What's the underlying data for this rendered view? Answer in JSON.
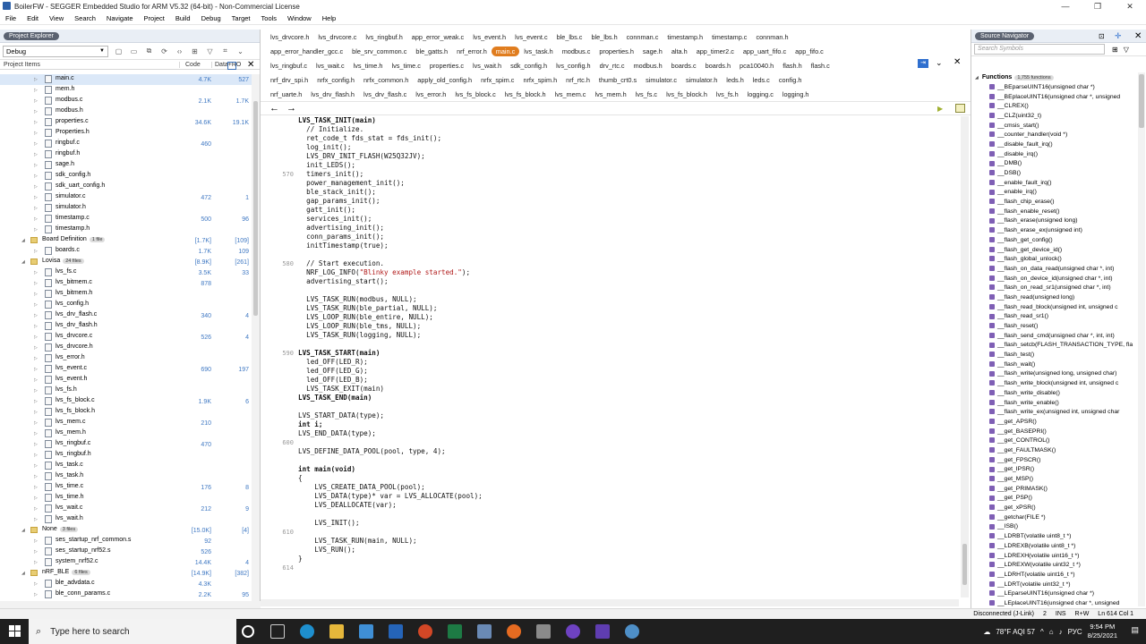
{
  "window": {
    "title": "BoilerFW - SEGGER Embedded Studio for ARM V5.32 (64-bit) - Non-Commercial License",
    "controls": [
      "—",
      "❐",
      "✕"
    ]
  },
  "menu": [
    "File",
    "Edit",
    "View",
    "Search",
    "Navigate",
    "Project",
    "Build",
    "Debug",
    "Target",
    "Tools",
    "Window",
    "Help"
  ],
  "project_explorer": {
    "title": "Project Explorer",
    "config": "Debug",
    "col_items": "Project Items",
    "col_code": "Code",
    "col_data": "Data+RO",
    "rows": [
      {
        "name": "main.c",
        "code": "4.7K",
        "data": "527",
        "indent": 2,
        "type": "file",
        "sel": true
      },
      {
        "name": "mem.h",
        "code": "",
        "data": "",
        "indent": 2,
        "type": "file"
      },
      {
        "name": "modbus.c",
        "code": "2.1K",
        "data": "1.7K",
        "indent": 2,
        "type": "file"
      },
      {
        "name": "modbus.h",
        "code": "",
        "data": "",
        "indent": 2,
        "type": "file"
      },
      {
        "name": "properties.c",
        "code": "34.6K",
        "data": "19.1K",
        "indent": 2,
        "type": "file"
      },
      {
        "name": "Properties.h",
        "code": "",
        "data": "",
        "indent": 2,
        "type": "file"
      },
      {
        "name": "ringbuf.c",
        "code": "460",
        "data": "",
        "indent": 2,
        "type": "file"
      },
      {
        "name": "ringbuf.h",
        "code": "",
        "data": "",
        "indent": 2,
        "type": "file"
      },
      {
        "name": "sage.h",
        "code": "",
        "data": "",
        "indent": 2,
        "type": "file"
      },
      {
        "name": "sdk_config.h",
        "code": "",
        "data": "",
        "indent": 2,
        "type": "file"
      },
      {
        "name": "sdk_uart_config.h",
        "code": "",
        "data": "",
        "indent": 2,
        "type": "file"
      },
      {
        "name": "simulator.c",
        "code": "472",
        "data": "1",
        "indent": 2,
        "type": "file"
      },
      {
        "name": "simulator.h",
        "code": "",
        "data": "",
        "indent": 2,
        "type": "file"
      },
      {
        "name": "timestamp.c",
        "code": "500",
        "data": "96",
        "indent": 2,
        "type": "file"
      },
      {
        "name": "timestamp.h",
        "code": "",
        "data": "",
        "indent": 2,
        "type": "file"
      },
      {
        "name": "Board Definition",
        "badge": "1 file",
        "code": "[1.7K]",
        "data": "[109]",
        "indent": 1,
        "type": "folder"
      },
      {
        "name": "boards.c",
        "code": "1.7K",
        "data": "109",
        "indent": 2,
        "type": "file"
      },
      {
        "name": "Lovisa",
        "badge": "24 files",
        "code": "[8.9K]",
        "data": "[261]",
        "indent": 1,
        "type": "folder"
      },
      {
        "name": "lvs_fs.c",
        "code": "3.5K",
        "data": "33",
        "indent": 2,
        "type": "file"
      },
      {
        "name": "lvs_bitmem.c",
        "code": "878",
        "data": "",
        "indent": 2,
        "type": "file"
      },
      {
        "name": "lvs_bitmem.h",
        "code": "",
        "data": "",
        "indent": 2,
        "type": "file"
      },
      {
        "name": "lvs_config.h",
        "code": "",
        "data": "",
        "indent": 2,
        "type": "file"
      },
      {
        "name": "lvs_drv_flash.c",
        "code": "340",
        "data": "4",
        "indent": 2,
        "type": "file"
      },
      {
        "name": "lvs_drv_flash.h",
        "code": "",
        "data": "",
        "indent": 2,
        "type": "file"
      },
      {
        "name": "lvs_drvcore.c",
        "code": "526",
        "data": "4",
        "indent": 2,
        "type": "file"
      },
      {
        "name": "lvs_drvcore.h",
        "code": "",
        "data": "",
        "indent": 2,
        "type": "file"
      },
      {
        "name": "lvs_error.h",
        "code": "",
        "data": "",
        "indent": 2,
        "type": "file"
      },
      {
        "name": "lvs_event.c",
        "code": "690",
        "data": "197",
        "indent": 2,
        "type": "file"
      },
      {
        "name": "lvs_event.h",
        "code": "",
        "data": "",
        "indent": 2,
        "type": "file"
      },
      {
        "name": "lvs_fs.h",
        "code": "",
        "data": "",
        "indent": 2,
        "type": "file"
      },
      {
        "name": "lvs_fs_block.c",
        "code": "1.9K",
        "data": "6",
        "indent": 2,
        "type": "file"
      },
      {
        "name": "lvs_fs_block.h",
        "code": "",
        "data": "",
        "indent": 2,
        "type": "file"
      },
      {
        "name": "lvs_mem.c",
        "code": "210",
        "data": "",
        "indent": 2,
        "type": "file"
      },
      {
        "name": "lvs_mem.h",
        "code": "",
        "data": "",
        "indent": 2,
        "type": "file"
      },
      {
        "name": "lvs_ringbuf.c",
        "code": "470",
        "data": "",
        "indent": 2,
        "type": "file"
      },
      {
        "name": "lvs_ringbuf.h",
        "code": "",
        "data": "",
        "indent": 2,
        "type": "file"
      },
      {
        "name": "lvs_task.c",
        "code": "",
        "data": "",
        "indent": 2,
        "type": "file"
      },
      {
        "name": "lvs_task.h",
        "code": "",
        "data": "",
        "indent": 2,
        "type": "file"
      },
      {
        "name": "lvs_time.c",
        "code": "176",
        "data": "8",
        "indent": 2,
        "type": "file"
      },
      {
        "name": "lvs_time.h",
        "code": "",
        "data": "",
        "indent": 2,
        "type": "file"
      },
      {
        "name": "lvs_wait.c",
        "code": "212",
        "data": "9",
        "indent": 2,
        "type": "file"
      },
      {
        "name": "lvs_wait.h",
        "code": "",
        "data": "",
        "indent": 2,
        "type": "file"
      },
      {
        "name": "None",
        "badge": "3 files",
        "code": "[15.0K]",
        "data": "[4]",
        "indent": 1,
        "type": "folder"
      },
      {
        "name": "ses_startup_nrf_common.s",
        "code": "92",
        "data": "",
        "indent": 2,
        "type": "file"
      },
      {
        "name": "ses_startup_nrf52.s",
        "code": "526",
        "data": "",
        "indent": 2,
        "type": "file"
      },
      {
        "name": "system_nrf52.c",
        "code": "14.4K",
        "data": "4",
        "indent": 2,
        "type": "file"
      },
      {
        "name": "nRF_BLE",
        "badge": "6 files",
        "code": "[14.9K]",
        "data": "[382]",
        "indent": 1,
        "type": "folder"
      },
      {
        "name": "ble_advdata.c",
        "code": "4.3K",
        "data": "",
        "indent": 2,
        "type": "file"
      },
      {
        "name": "ble_conn_params.c",
        "code": "2.2K",
        "data": "95",
        "indent": 2,
        "type": "file"
      }
    ]
  },
  "editor": {
    "tabs_row1": [
      "lvs_drvcore.h",
      "lvs_drvcore.c",
      "lvs_ringbuf.h",
      "app_error_weak.c",
      "lvs_event.h",
      "lvs_event.c",
      "ble_lbs.c",
      "ble_lbs.h",
      "connman.c",
      "timestamp.h",
      "timestamp.c",
      "connman.h"
    ],
    "tabs_row2": [
      "app_error_handler_gcc.c",
      "ble_srv_common.c",
      "ble_gatts.h",
      "nrf_error.h",
      "main.c",
      "lvs_task.h",
      "modbus.c",
      "properties.h",
      "sage.h",
      "alta.h",
      "app_timer2.c",
      "app_uart_fifo.c",
      "app_fifo.c"
    ],
    "tabs_row3": [
      "lvs_ringbuf.c",
      "lvs_wait.c",
      "lvs_time.h",
      "lvs_time.c",
      "properties.c",
      "lvs_wait.h",
      "sdk_config.h",
      "lvs_config.h",
      "drv_rtc.c",
      "modbus.h",
      "boards.c",
      "boards.h",
      "pca10040.h",
      "flash.h",
      "flash.c"
    ],
    "tabs_row4": [
      "nrf_drv_spi.h",
      "nrfx_config.h",
      "nrfx_common.h",
      "apply_old_config.h",
      "nrfx_spim.c",
      "nrfx_spim.h",
      "nrf_rtc.h",
      "thumb_crt0.s",
      "simulator.c",
      "simulator.h",
      "leds.h",
      "leds.c",
      "config.h"
    ],
    "tabs_row5": [
      "nrf_uarte.h",
      "lvs_drv_flash.h",
      "lvs_drv_flash.c",
      "lvs_error.h",
      "lvs_fs_block.c",
      "lvs_fs_block.h",
      "lvs_mem.c",
      "lvs_mem.h",
      "lvs_fs.c",
      "lvs_fs_block.h",
      "lvs_fs.h",
      "logging.c",
      "logging.h"
    ],
    "active_tab": "main.c",
    "lines": [
      {
        "n": "",
        "t": "LVS_TASK_INIT(main)"
      },
      {
        "n": "",
        "t": "  // Initialize.",
        "c": "cm"
      },
      {
        "n": "",
        "t": "  ret_code_t fds_stat = fds_init();"
      },
      {
        "n": "",
        "t": "  log_init();"
      },
      {
        "n": "",
        "t": "  LVS_DRV_INIT_FLASH(W25Q32JV);"
      },
      {
        "n": "",
        "t": "  init_LEDS();"
      },
      {
        "n": "570",
        "t": "  timers_init();"
      },
      {
        "n": "",
        "t": "  power_management_init();"
      },
      {
        "n": "",
        "t": "  ble_stack_init();"
      },
      {
        "n": "",
        "t": "  gap_params_init();"
      },
      {
        "n": "",
        "t": "  gatt_init();"
      },
      {
        "n": "",
        "t": "  services_init();"
      },
      {
        "n": "",
        "t": "  advertising_init();"
      },
      {
        "n": "",
        "t": "  conn_params_init();"
      },
      {
        "n": "",
        "t": "  initTimestamp(true);"
      },
      {
        "n": "",
        "t": ""
      },
      {
        "n": "580",
        "t": "  // Start execution.",
        "c": "cm"
      },
      {
        "n": "",
        "t": "  NRF_LOG_INFO(\"Blinky example started.\");"
      },
      {
        "n": "",
        "t": "  advertising_start();"
      },
      {
        "n": "",
        "t": ""
      },
      {
        "n": "",
        "t": "  LVS_TASK_RUN(modbus, NULL);"
      },
      {
        "n": "",
        "t": "  LVS_TASK_RUN(ble_partial, NULL);"
      },
      {
        "n": "",
        "t": "  LVS_LOOP_RUN(ble_entire, NULL);"
      },
      {
        "n": "",
        "t": "  LVS_LOOP_RUN(ble_tms, NULL);"
      },
      {
        "n": "",
        "t": "  LVS_TASK_RUN(logging, NULL);"
      },
      {
        "n": "",
        "t": ""
      },
      {
        "n": "590",
        "t": "LVS_TASK_START(main)"
      },
      {
        "n": "",
        "t": "  led_OFF(LED_R);"
      },
      {
        "n": "",
        "t": "  led_OFF(LED_G);"
      },
      {
        "n": "",
        "t": "  led_OFF(LED_B);"
      },
      {
        "n": "",
        "t": "  LVS_TASK_EXIT(main)"
      },
      {
        "n": "",
        "t": "LVS_TASK_END(main)"
      },
      {
        "n": "",
        "t": ""
      },
      {
        "n": "",
        "t": "LVS_START_DATA(type);"
      },
      {
        "n": "",
        "t": "int i;"
      },
      {
        "n": "",
        "t": "LVS_END_DATA(type);"
      },
      {
        "n": "600",
        "t": ""
      },
      {
        "n": "",
        "t": "LVS_DEFINE_DATA_POOL(pool, type, 4);"
      },
      {
        "n": "",
        "t": ""
      },
      {
        "n": "",
        "t": "int main(void)"
      },
      {
        "n": "",
        "t": "{"
      },
      {
        "n": "",
        "t": "    LVS_CREATE_DATA_POOL(pool);"
      },
      {
        "n": "",
        "t": "    LVS_DATA(type)* var = LVS_ALLOCATE(pool);"
      },
      {
        "n": "",
        "t": "    LVS_DEALLOCATE(var);"
      },
      {
        "n": "",
        "t": ""
      },
      {
        "n": "",
        "t": "    LVS_INIT();"
      },
      {
        "n": "610",
        "t": ""
      },
      {
        "n": "",
        "t": "    LVS_TASK_RUN(main, NULL);"
      },
      {
        "n": "",
        "t": "    LVS_RUN();"
      },
      {
        "n": "",
        "t": "}"
      },
      {
        "n": "614",
        "t": ""
      }
    ]
  },
  "source_navigator": {
    "title": "Source Navigator",
    "search_placeholder": "Search Symbols",
    "group": "Functions",
    "count": "1,755 functions",
    "symbols": [
      "__BEparseUINT16(unsigned char *)",
      "__BEplaceUINT16(unsigned char *, unsigned",
      "__CLREX()",
      "__CLZ(uint32_t)",
      "__cmsis_start()",
      "__counter_handler(void *)",
      "__disable_fault_irq()",
      "__disable_irq()",
      "__DMB()",
      "__DSB()",
      "__enable_fault_irq()",
      "__enable_irq()",
      "__flash_chip_erase()",
      "__flash_enable_reset()",
      "__flash_erase(unsigned long)",
      "__flash_erase_ex(unsigned int)",
      "__flash_get_config()",
      "__flash_get_device_id()",
      "__flash_global_unlock()",
      "__flash_on_data_read(unsigned char *, int)",
      "__flash_on_device_id(unsigned char *, int)",
      "__flash_on_read_sr1(unsigned char *, int)",
      "__flash_read(unsigned long)",
      "__flash_read_block(unsigned int, unsigned c",
      "__flash_read_sr1()",
      "__flash_reset()",
      "__flash_send_cmd(unsigned char *, int, int)",
      "__flash_setcb(FLASH_TRANSACTION_TYPE, fla",
      "__flash_test()",
      "__flash_wait()",
      "__flash_write(unsigned long, unsigned char)",
      "__flash_write_block(unsigned int, unsigned c",
      "__flash_write_disable()",
      "__flash_write_enable()",
      "__flash_write_ex(unsigned int, unsigned char",
      "__get_APSR()",
      "__get_BASEPRI()",
      "__get_CONTROL()",
      "__get_FAULTMASK()",
      "__get_FPSCR()",
      "__get_IPSR()",
      "__get_MSP()",
      "__get_PRIMASK()",
      "__get_PSP()",
      "__get_xPSR()",
      "__getchar(FILE *)",
      "__ISB()",
      "__LDRBT(volatile uint8_t *)",
      "__LDREXB(volatile uint8_t *)",
      "__LDREXH(volatile uint16_t *)",
      "__LDREXW(volatile uint32_t *)",
      "__LDRHT(volatile uint16_t *)",
      "__LDRT(volatile uint32_t *)",
      "__LEparseUINT16(unsigned char *)",
      "__LEplaceUINT16(unsigned char *, unsigned"
    ]
  },
  "status": {
    "conn": "Disconnected (J-Link)",
    "info": "2",
    "ins": "INS",
    "rw": "R+W",
    "pos": "Ln 614 Col 1"
  },
  "taskbar": {
    "search": "Type here to search",
    "weather": "78°F AQI 57",
    "lang": "РУС",
    "time": "9:54 PM",
    "date": "8/25/2021",
    "notif": "2"
  }
}
